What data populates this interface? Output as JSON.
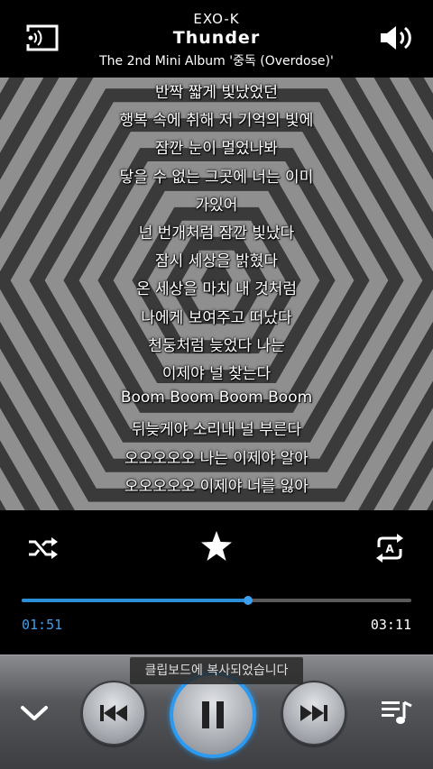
{
  "header": {
    "artist": "EXO-K",
    "title": "Thunder",
    "album": "The 2nd Mini Album '중독 (Overdose)'"
  },
  "icons": {
    "cast": "cast-icon",
    "volume": "volume-icon",
    "shuffle": "shuffle-icon",
    "favorite": "star-icon",
    "repeat": "repeat-icon",
    "collapse": "chevron-down-icon",
    "previous": "previous-track-icon",
    "pause": "pause-icon",
    "next": "next-track-icon",
    "playlist": "playlist-icon"
  },
  "lyrics": [
    "반짝 짧게 빛났었던",
    "행복 속에 취해 저 기억의 빛에",
    "잠깐 눈이 멀었나봐",
    "닿을 수 없는 그곳에 너는 이미",
    "가있어",
    "넌 번개처럼 잠깐 빛났다",
    "잠시 세상을 밝혔다",
    "온 세상을 마치 내 것처럼",
    "나에게 보여주고 떠났다",
    "천둥처럼 늦었다 나는",
    "이제야 널 찾는다",
    "Boom Boom Boom Boom",
    "뒤늦게야 소리내 널 부른다",
    "오오오오오 나는 이제야 알아",
    "오오오오오 이제야 너를 잃아"
  ],
  "player": {
    "elapsed": "01:51",
    "total": "03:11",
    "progress_fraction": 0.58
  },
  "toast": "클립보드에 복사되었습니다",
  "colors": {
    "accent": "#2b9af0",
    "artwork_bg": "#3a3a3a",
    "artwork_stripe": "#8f8f8f"
  }
}
